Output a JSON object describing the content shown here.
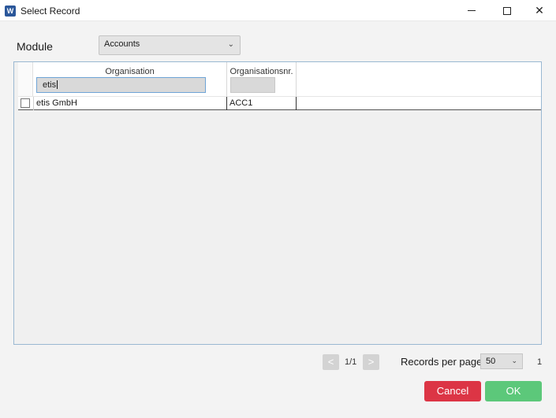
{
  "window": {
    "title": "Select Record",
    "app_icon_letter": "W"
  },
  "module": {
    "label": "Module",
    "selected": "Accounts"
  },
  "grid": {
    "columns": [
      {
        "label": "Organisation",
        "filter_value": "etis"
      },
      {
        "label": "Organisationsnr.",
        "filter_value": ""
      }
    ],
    "rows": [
      {
        "organisation": "etis GmbH",
        "organisationsnr": "ACC1",
        "checked": false
      }
    ]
  },
  "pager": {
    "prev": "<",
    "next": ">",
    "page_info": "1/1",
    "records_per_page_label": "Records per page",
    "records_per_page": "50",
    "total": "1"
  },
  "buttons": {
    "cancel": "Cancel",
    "ok": "OK"
  },
  "colors": {
    "cancel": "#dc3545",
    "ok": "#5cc87a",
    "grid_border": "#9ab8d2"
  },
  "icons": {
    "app": "word-app-icon",
    "minimize": "minimize-icon",
    "maximize": "maximize-icon",
    "close": "close-icon",
    "dropdown": "chevron-down-icon"
  }
}
